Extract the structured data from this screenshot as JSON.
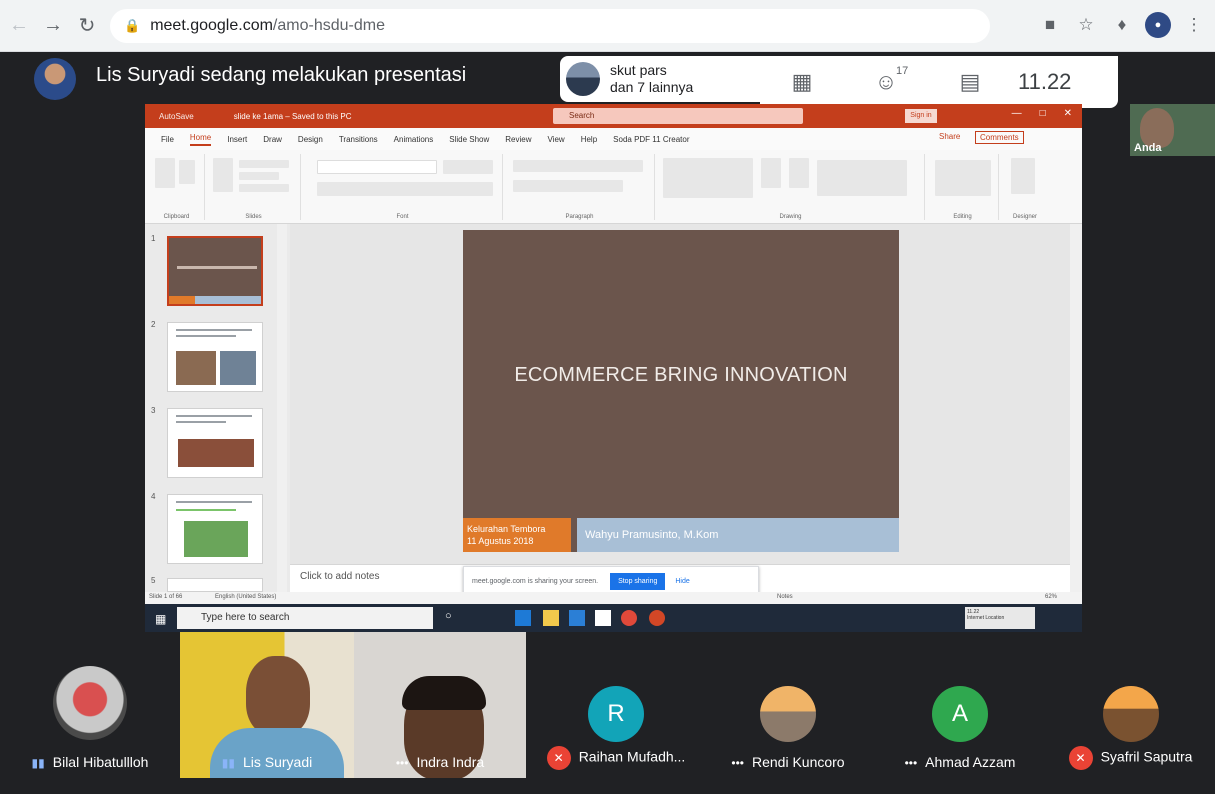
{
  "browser": {
    "back_icon": "arrow-left-icon",
    "forward_icon": "arrow-right-icon",
    "reload_icon": "reload-icon",
    "url_host": "meet.google.com",
    "url_path": "/amo-hsdu-dme"
  },
  "meet": {
    "presenter_text": "Lis Suryadi sedang melakukan presentasi",
    "viewer_name": "skut pars",
    "viewer_more": "dan 7 lainnya",
    "participants_count": "17",
    "time": "11.22",
    "self_label": "Anda"
  },
  "ppt": {
    "autosave": "AutoSave",
    "file_title": "slide ke 1ama – Saved to this PC",
    "search_placeholder": "Search",
    "signin": "Sign in",
    "tabs": [
      "File",
      "Home",
      "Insert",
      "Draw",
      "Design",
      "Transitions",
      "Animations",
      "Slide Show",
      "Review",
      "View",
      "Help",
      "Soda PDF 11 Creator"
    ],
    "share": "Share",
    "comments": "Comments",
    "groups": [
      "Clipboard",
      "Slides",
      "Font",
      "Paragraph",
      "Drawing",
      "Editing",
      "Designer"
    ],
    "slide_numbers": [
      "1",
      "2",
      "3",
      "4",
      "5"
    ],
    "slide_title": "ECOMMERCE BRING INNOVATION",
    "slide_left_line1": "Kelurahan Tembora",
    "slide_left_line2": "11 Agustus 2018",
    "slide_right": "Wahyu Pramusinto, M.Kom",
    "notes_placeholder": "Click to add notes",
    "status_left": "Slide 1 of 66",
    "status_lang": "English (United States)",
    "notes_btn": "Notes",
    "zoom": "62%"
  },
  "share_bar": {
    "message": "meet.google.com is sharing your screen.",
    "stop_label": "Stop sharing",
    "hide_label": "Hide"
  },
  "taskbar": {
    "search_placeholder": "Type here to search",
    "tray_line1": "11.22",
    "tray_line2": "Internet Location"
  },
  "participants": [
    {
      "name": "Bilal Hibatullloh"
    },
    {
      "name": "Lis Suryadi"
    },
    {
      "name": "Indra Indra"
    },
    {
      "name": "Raihan Mufadh...",
      "initial": "R"
    },
    {
      "name": "Rendi Kuncoro"
    },
    {
      "name": "Ahmad Azzam",
      "initial": "A"
    },
    {
      "name": "Syafril Saputra"
    }
  ],
  "colors": {
    "ppt_accent": "#c43e1c",
    "slide_bg": "#6b554c",
    "slide_orange": "#e07a2a",
    "slide_blue": "#a8bfd6",
    "raihan_avatar": "#12a4b8",
    "ahmad_avatar": "#2fa84f",
    "mic_off": "#ea4335"
  }
}
